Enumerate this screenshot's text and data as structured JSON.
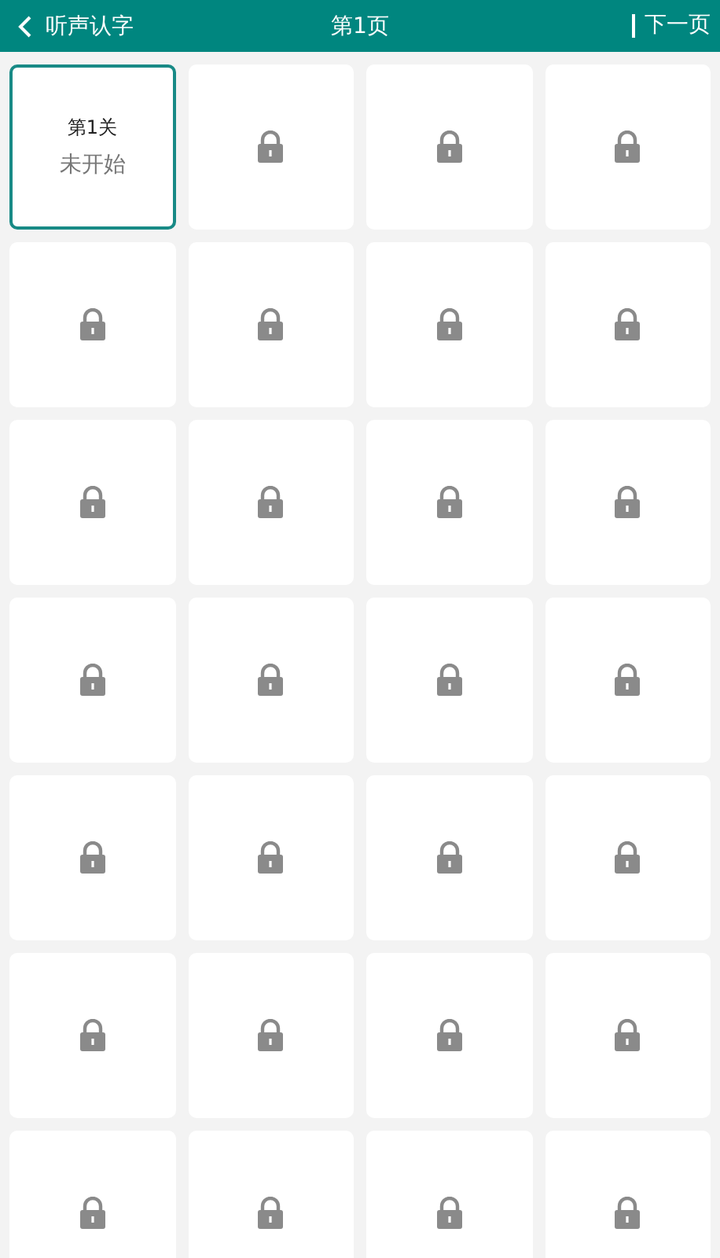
{
  "header": {
    "title": "听声认字",
    "page": "第1页",
    "next": "下一页"
  },
  "levels": [
    {
      "kind": "open",
      "title": "第1关",
      "status": "未开始",
      "selected": true
    },
    {
      "kind": "locked",
      "selected": false
    },
    {
      "kind": "locked",
      "selected": false
    },
    {
      "kind": "locked",
      "selected": false
    },
    {
      "kind": "locked",
      "selected": false
    },
    {
      "kind": "locked",
      "selected": false
    },
    {
      "kind": "locked",
      "selected": false
    },
    {
      "kind": "locked",
      "selected": false
    },
    {
      "kind": "locked",
      "selected": false
    },
    {
      "kind": "locked",
      "selected": false
    },
    {
      "kind": "locked",
      "selected": false
    },
    {
      "kind": "locked",
      "selected": false
    },
    {
      "kind": "locked",
      "selected": false
    },
    {
      "kind": "locked",
      "selected": false
    },
    {
      "kind": "locked",
      "selected": false
    },
    {
      "kind": "locked",
      "selected": false
    },
    {
      "kind": "locked",
      "selected": false
    },
    {
      "kind": "locked",
      "selected": false
    },
    {
      "kind": "locked",
      "selected": false
    },
    {
      "kind": "locked",
      "selected": false
    },
    {
      "kind": "locked",
      "selected": false
    },
    {
      "kind": "locked",
      "selected": false
    },
    {
      "kind": "locked",
      "selected": false
    },
    {
      "kind": "locked",
      "selected": false
    },
    {
      "kind": "locked",
      "selected": false
    },
    {
      "kind": "locked",
      "selected": false
    },
    {
      "kind": "locked",
      "selected": false
    },
    {
      "kind": "locked",
      "selected": false
    }
  ]
}
